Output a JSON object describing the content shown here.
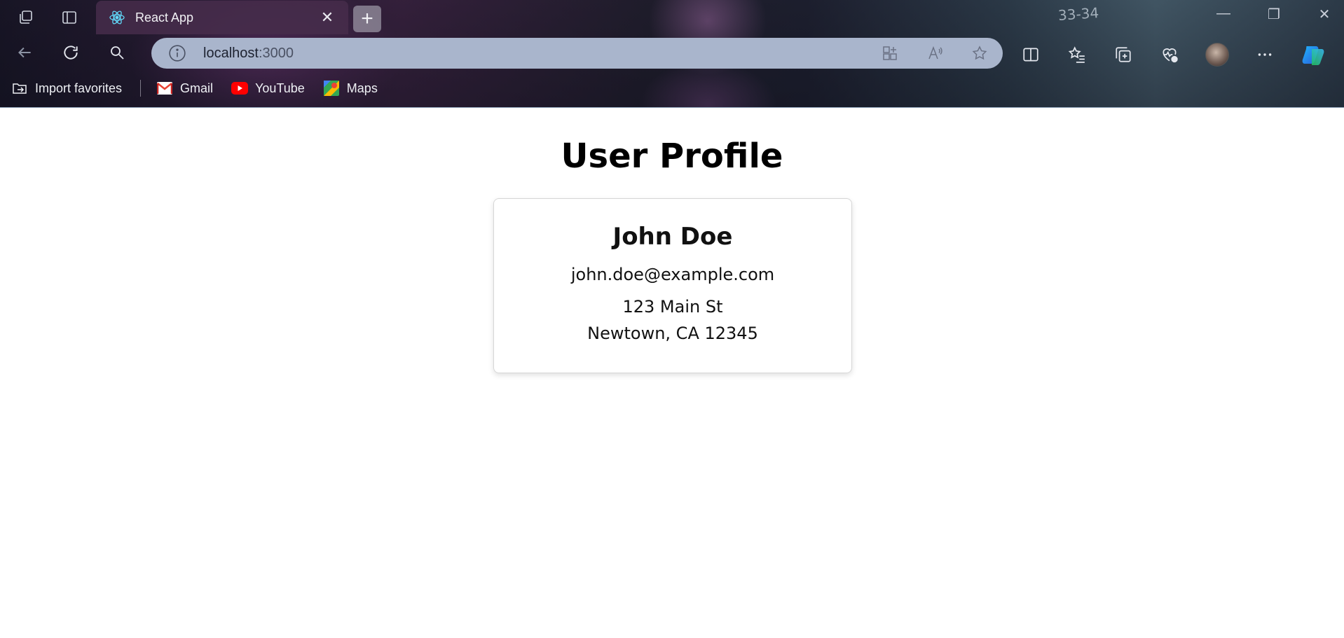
{
  "browser": {
    "tab": {
      "title": "React App"
    },
    "address": {
      "host": "localhost",
      "port": ":3000"
    },
    "favorites": [
      {
        "label": "Import favorites",
        "icon": "import-favorites-icon"
      },
      {
        "label": "Gmail",
        "icon": "gmail-icon"
      },
      {
        "label": "YouTube",
        "icon": "youtube-icon"
      },
      {
        "label": "Maps",
        "icon": "maps-icon"
      }
    ],
    "background_text": "33-34",
    "colors": {
      "address_bar": "#a9b5cc",
      "react": "#61dafb",
      "youtube": "#ff0000"
    }
  },
  "page": {
    "title": "User Profile",
    "user": {
      "name": "John Doe",
      "email": "john.doe@example.com",
      "street": "123 Main St",
      "city": "Newtown, CA 12345"
    }
  }
}
